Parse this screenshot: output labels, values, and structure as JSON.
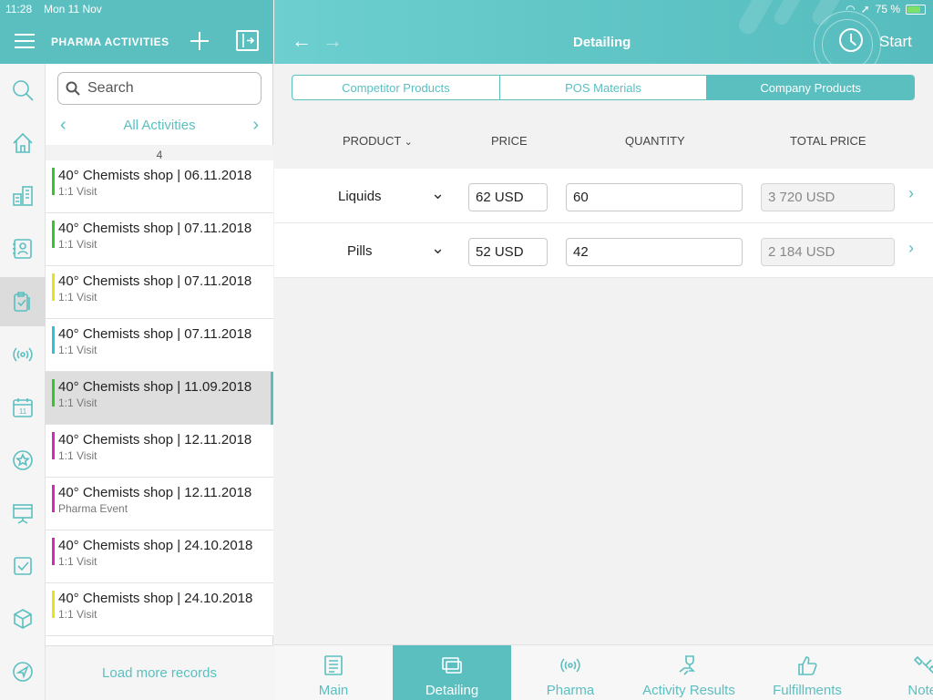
{
  "status_bar": {
    "time": "11:28",
    "date": "Mon 11 Nov",
    "battery": "75 %"
  },
  "left_header": {
    "title": "PHARMA ACTIVITIES"
  },
  "detail_header": {
    "title": "Detailing",
    "start_label": "Start"
  },
  "search": {
    "placeholder": "Search"
  },
  "filter": {
    "label": "All Activities"
  },
  "list": {
    "count": "4",
    "items": [
      {
        "title": "40° Chemists shop | 06.11.2018",
        "subtitle": "1:1 Visit",
        "color": "#35c62c"
      },
      {
        "title": "40° Chemists shop | 07.11.2018",
        "subtitle": "1:1 Visit",
        "color": "#35c62c"
      },
      {
        "title": "40° Chemists shop | 07.11.2018",
        "subtitle": "1:1 Visit",
        "color": "#e8e317"
      },
      {
        "title": "40° Chemists shop | 07.11.2018",
        "subtitle": "1:1 Visit",
        "color": "#2cc4d9"
      },
      {
        "title": "40° Chemists shop | 11.09.2018",
        "subtitle": "1:1 Visit",
        "color": "#35c62c"
      },
      {
        "title": "40° Chemists shop | 12.11.2018",
        "subtitle": "1:1 Visit",
        "color": "#d42ab8"
      },
      {
        "title": "40° Chemists shop | 12.11.2018",
        "subtitle": "Pharma Event",
        "color": "#d42ab8"
      },
      {
        "title": "40° Chemists shop | 24.10.2018",
        "subtitle": "1:1 Visit",
        "color": "#d42ab8"
      },
      {
        "title": "40° Chemists shop | 24.10.2018",
        "subtitle": "1:1 Visit",
        "color": "#e8e317"
      }
    ],
    "load_more": "Load more records"
  },
  "segments": [
    "Competitor Products",
    "POS Materials",
    "Company Products"
  ],
  "table": {
    "headers": {
      "product": "PRODUCT",
      "price": "PRICE",
      "quantity": "QUANTITY",
      "total": "TOTAL PRICE"
    },
    "rows": [
      {
        "product": "Liquids",
        "price": "62 USD",
        "quantity": "60",
        "total": "3 720 USD"
      },
      {
        "product": "Pills",
        "price": "52 USD",
        "quantity": "42",
        "total": "2 184 USD"
      }
    ]
  },
  "tabs": [
    {
      "label": "Main",
      "icon": "document-list-icon"
    },
    {
      "label": "Detailing",
      "icon": "detailing-screens-icon"
    },
    {
      "label": "Pharma",
      "icon": "broadcast-icon"
    },
    {
      "label": "Activity Results",
      "icon": "trophy-hand-icon"
    },
    {
      "label": "Fulfillments",
      "icon": "thumbs-up-icon"
    },
    {
      "label": "Notes",
      "icon": "satellite-icon"
    }
  ],
  "sidebar_icons": [
    "search-icon",
    "home-icon",
    "buildings-icon",
    "contacts-icon",
    "activities-icon",
    "broadcast-icon",
    "calendar-icon",
    "star-badge-icon",
    "presentation-icon",
    "checkbox-icon",
    "cube-icon",
    "navigation-icon"
  ],
  "calendar_day": "11",
  "colors": {
    "accent": "#5bbfc0",
    "selected_row": "#dedede"
  }
}
